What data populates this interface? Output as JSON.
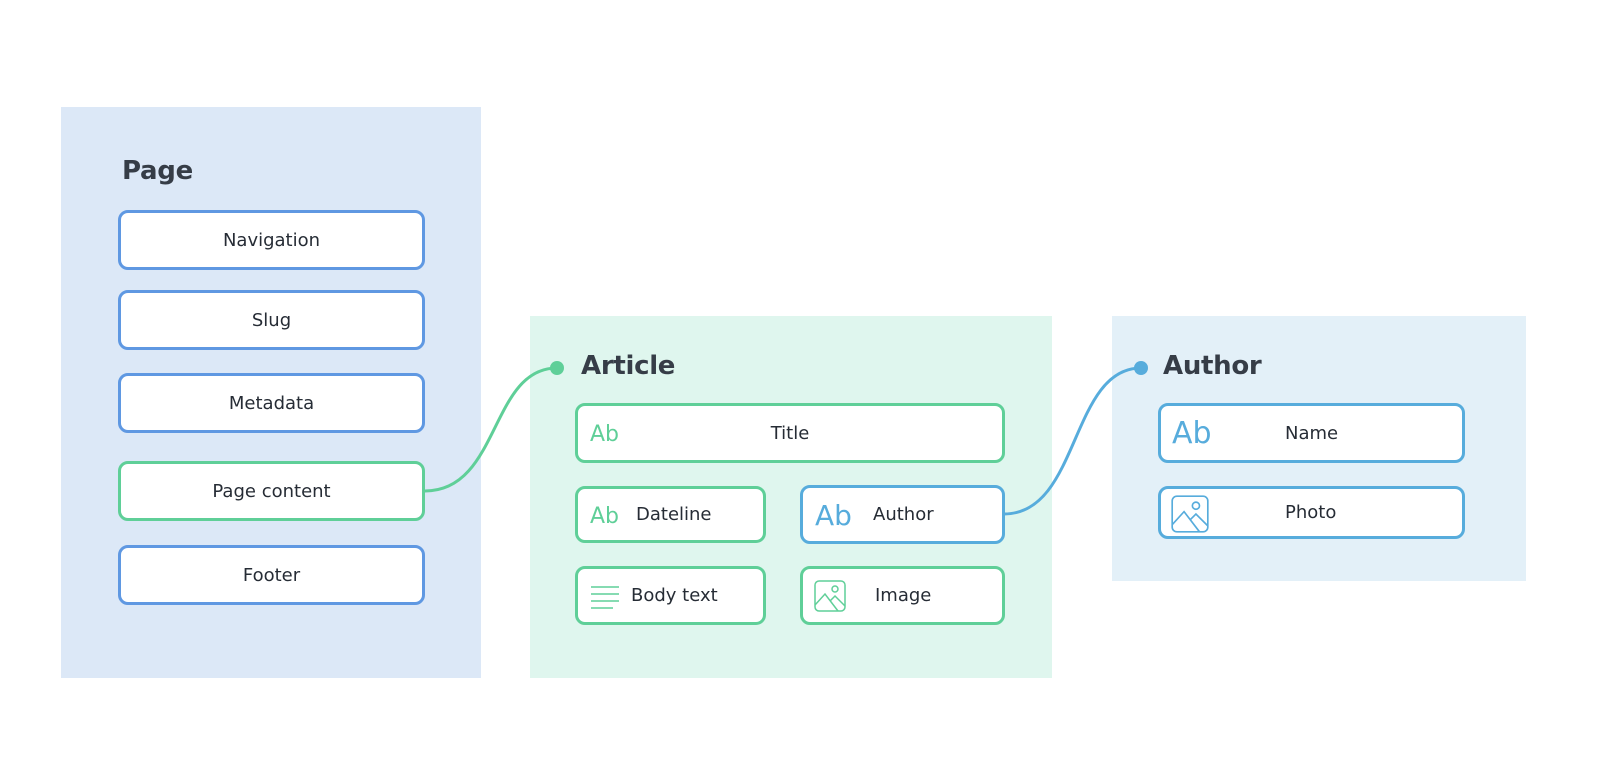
{
  "colors": {
    "page_panel_bg": "#dce8f7",
    "article_panel_bg": "#dff6ee",
    "author_panel_bg": "#e3f0f8",
    "blue_border": "#5f98e2",
    "green_accent": "#5fcf98",
    "sky_accent": "#57acdc",
    "heading_text": "#363d47"
  },
  "page": {
    "title": "Page",
    "fields": [
      {
        "label": "Navigation"
      },
      {
        "label": "Slug"
      },
      {
        "label": "Metadata"
      },
      {
        "label": "Page content",
        "linked_to": "Article"
      },
      {
        "label": "Footer"
      }
    ]
  },
  "article": {
    "title": "Article",
    "fields": [
      {
        "label": "Title",
        "icon": "text-ab-icon"
      },
      {
        "label": "Dateline",
        "icon": "text-ab-icon"
      },
      {
        "label": "Author",
        "icon": "text-ab-icon",
        "linked_to": "Author"
      },
      {
        "label": "Body text",
        "icon": "lines-icon"
      },
      {
        "label": "Image",
        "icon": "image-icon"
      }
    ]
  },
  "author": {
    "title": "Author",
    "fields": [
      {
        "label": "Name",
        "icon": "text-ab-icon"
      },
      {
        "label": "Photo",
        "icon": "image-icon"
      }
    ]
  },
  "icons": {
    "text_glyph": "Ab"
  },
  "connections": [
    {
      "from": "Page content",
      "to": "Article",
      "color": "green"
    },
    {
      "from": "Author",
      "to": "Author",
      "color": "sky"
    }
  ]
}
